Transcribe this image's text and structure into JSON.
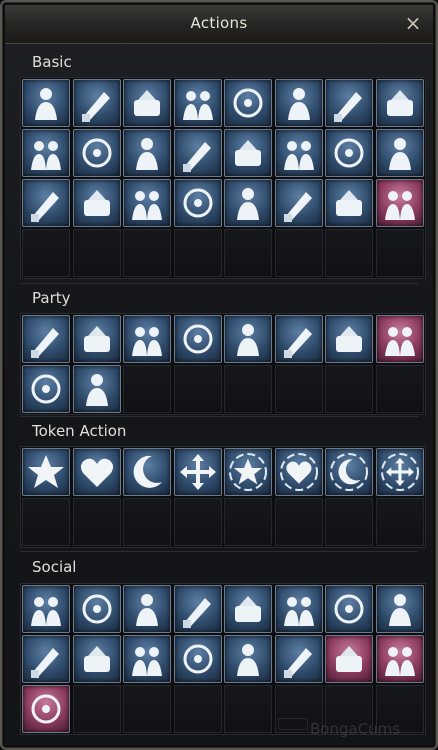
{
  "window": {
    "title": "Actions",
    "close_label": "×"
  },
  "sections": [
    {
      "label": "Basic",
      "icons": [
        {
          "name": "sit-icon",
          "pink": false
        },
        {
          "name": "run-icon",
          "pink": false
        },
        {
          "name": "attack-icon",
          "pink": false
        },
        {
          "name": "pick-up-icon",
          "pink": false
        },
        {
          "name": "assist-target-icon",
          "pink": false
        },
        {
          "name": "walk-icon",
          "pink": false
        },
        {
          "name": "next-target-icon",
          "pink": false
        },
        {
          "name": "private-store-sell-icon",
          "pink": false
        },
        {
          "name": "private-store-buy-icon",
          "pink": false
        },
        {
          "name": "hand-pointer-icon",
          "pink": false
        },
        {
          "name": "manufacture-icon",
          "pink": false
        },
        {
          "name": "trade-icon",
          "pink": false
        },
        {
          "name": "find-target-icon",
          "pink": false
        },
        {
          "name": "duel-icon",
          "pink": false
        },
        {
          "name": "party-duel-icon",
          "pink": false
        },
        {
          "name": "package-sell-all-icon",
          "pink": false
        },
        {
          "name": "chess-icon",
          "pink": false
        },
        {
          "name": "book-return-icon",
          "pink": false
        },
        {
          "name": "robot-mount-icon",
          "pink": false
        },
        {
          "name": "name-display-icon",
          "pink": false
        },
        {
          "name": "couple-icon",
          "pink": false
        },
        {
          "name": "record-video-icon",
          "pink": false
        },
        {
          "name": "microphone-icon",
          "pink": false
        },
        {
          "name": "refresh-search-icon",
          "pink": true
        }
      ],
      "empty_slots": 8
    },
    {
      "label": "Party",
      "icons": [
        {
          "name": "party-invite-icon",
          "pink": false
        },
        {
          "name": "party-swords-icon",
          "pink": false
        },
        {
          "name": "party-loot-icon",
          "pink": false
        },
        {
          "name": "party-leave-icon",
          "pink": false
        },
        {
          "name": "party-pet-icon",
          "pink": false
        },
        {
          "name": "party-chat-icon",
          "pink": false
        },
        {
          "name": "party-battle-icon",
          "pink": false
        },
        {
          "name": "party-question-icon",
          "pink": true
        },
        {
          "name": "party-summon-icon",
          "pink": false
        },
        {
          "name": "party-hug-icon",
          "pink": false
        }
      ],
      "empty_slots": 6
    },
    {
      "label": "Token Action",
      "icons": [
        {
          "name": "star-icon",
          "pink": false
        },
        {
          "name": "heart-icon",
          "pink": false
        },
        {
          "name": "moon-icon",
          "pink": false
        },
        {
          "name": "move-arrows-icon",
          "pink": false
        },
        {
          "name": "star-target-icon",
          "pink": false
        },
        {
          "name": "heart-target-icon",
          "pink": false
        },
        {
          "name": "moon-target-icon",
          "pink": false
        },
        {
          "name": "arrows-target-icon",
          "pink": false
        }
      ],
      "empty_slots": 8
    },
    {
      "label": "Social",
      "icons": [
        {
          "name": "greet-icon",
          "pink": false
        },
        {
          "name": "victory-icon",
          "pink": false
        },
        {
          "name": "advance-icon",
          "pink": false
        },
        {
          "name": "no-icon",
          "pink": false
        },
        {
          "name": "bow-icon",
          "pink": false
        },
        {
          "name": "unaware-icon",
          "pink": false
        },
        {
          "name": "waiting-icon",
          "pink": false
        },
        {
          "name": "laugh-icon",
          "pink": false
        },
        {
          "name": "applaud-icon",
          "pink": false
        },
        {
          "name": "hand-wave-icon",
          "pink": false
        },
        {
          "name": "dance-icon",
          "pink": false
        },
        {
          "name": "sad-icon",
          "pink": false
        },
        {
          "name": "charm-icon",
          "pink": false
        },
        {
          "name": "shyness-icon",
          "pink": false
        },
        {
          "name": "couple-bow-icon",
          "pink": true
        },
        {
          "name": "high-five-icon",
          "pink": true
        },
        {
          "name": "couple-dance-icon",
          "pink": true
        }
      ],
      "empty_slots": 7
    }
  ],
  "watermark": "BongaCums"
}
